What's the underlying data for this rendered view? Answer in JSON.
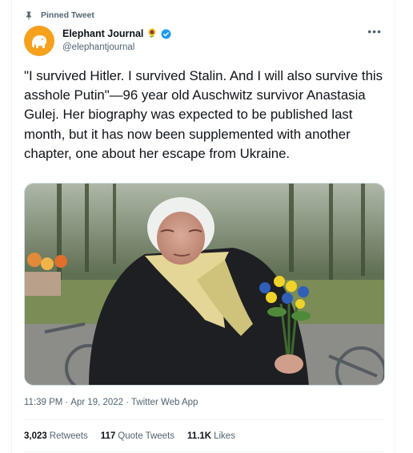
{
  "pinned_label": "Pinned Tweet",
  "author": {
    "name": "Elephant Journal",
    "emoji": "🌻",
    "handle": "@elephantjournal",
    "verified": true
  },
  "tweet_text": "\"I survived Hitler. I survived Stalin. And I will also survive this asshole Putin\"—96 year old Auschwitz survivor Anastasia Gulej. Her biography was expected to be published last month, but it has now been supplemented with another chapter, one about her escape from Ukraine.",
  "timestamp": {
    "time": "11:39 PM",
    "date": "Apr 19, 2022",
    "app": "Twitter Web App"
  },
  "stats": {
    "retweets": {
      "count": "3,023",
      "label": "Retweets"
    },
    "quotes": {
      "count": "117",
      "label": "Quote Tweets"
    },
    "likes": {
      "count": "11.1K",
      "label": "Likes"
    }
  },
  "colors": {
    "brand_orange": "#f5a11e",
    "verified_blue": "#1d9bf0",
    "muted_text": "#536471"
  }
}
